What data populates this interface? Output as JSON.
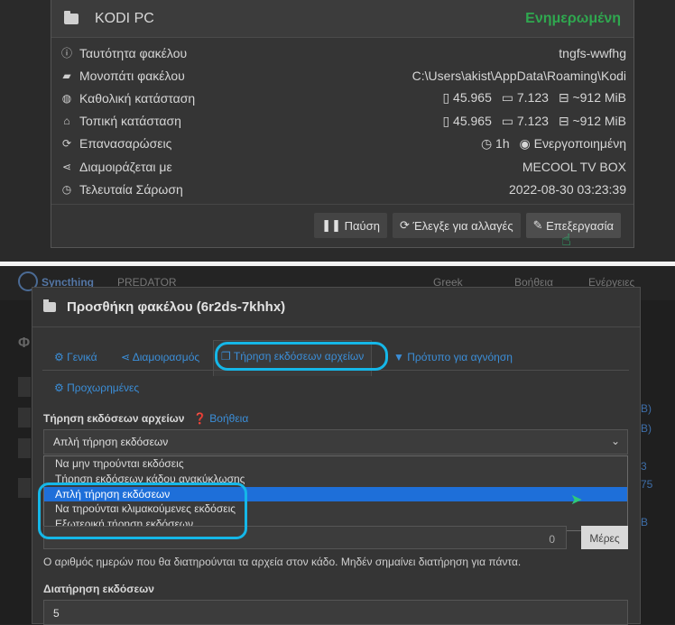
{
  "folder_panel": {
    "title": "KODI PC",
    "status": "Ενημερωμένη",
    "rows": [
      {
        "icon": "info-circle-icon",
        "label": "Ταυτότητα φακέλου",
        "value": "tngfs-wwfhg"
      },
      {
        "icon": "folder-open-icon",
        "label": "Μονοπάτι φακέλου",
        "value": "C:\\Users\\akist\\AppData\\Roaming\\Kodi"
      },
      {
        "icon": "globe-icon",
        "label": "Καθολική κατάσταση",
        "files": "45.965",
        "dirs": "7.123",
        "size": "~912 MiB"
      },
      {
        "icon": "home-icon",
        "label": "Τοπική κατάσταση",
        "files": "45.965",
        "dirs": "7.123",
        "size": "~912 MiB"
      },
      {
        "icon": "refresh-icon",
        "label": "Επανασαρώσεις",
        "interval": "1h",
        "watch": "Ενεργοποιημένη"
      },
      {
        "icon": "share-icon",
        "label": "Διαμοιράζεται με",
        "value": "MECOOL TV BOX"
      },
      {
        "icon": "clock-icon",
        "label": "Τελευταία Σάρωση",
        "value": "2022-08-30 03:23:39"
      }
    ],
    "buttons": {
      "pause": "Παύση",
      "rescan": "Έλεγξε για αλλαγές",
      "edit": "Επεξεργασία"
    }
  },
  "navbar": {
    "brand": "Syncthing",
    "device": "PREDATOR",
    "language": "Greek",
    "help": "Βοήθεια",
    "actions": "Ενέργειες"
  },
  "modal": {
    "title": "Προσθήκη φακέλου (6r2ds-7khhx)",
    "tabs": [
      {
        "label": "Γενικά",
        "icon": "cog-icon"
      },
      {
        "label": "Διαμοιρασμός",
        "icon": "share-icon"
      },
      {
        "label": "Τήρηση εκδόσεων αρχείων",
        "icon": "copy-icon",
        "active": true
      },
      {
        "label": "Πρότυπο για αγνόηση",
        "icon": "filter-icon"
      },
      {
        "label": "Προχωρημένες",
        "icon": "cogs-icon"
      }
    ],
    "versioning_label": "Τήρηση εκδόσεων αρχείων",
    "help_link": "Βοήθεια",
    "selected_value": "Απλή τήρηση εκδόσεων",
    "options": [
      "Να μην τηρούνται εκδόσεις",
      "Τήρηση εκδόσεων κάδου ανακύκλωσης",
      "Απλή τήρηση εκδόσεων",
      "Να τηρούνται κλιμακούμενες εκδόσεις",
      "Εξωτερική τήρηση εκδόσεων"
    ],
    "cleanout_days_value": "0",
    "days_addon": "Μέρες",
    "cleanout_hint": "Ο αριθμός ημερών που θα διατηρούνται τα αρχεία στον κάδο. Μηδέν σημαίνει διατήρηση για πάντα.",
    "keep_versions_label": "Διατήρηση εκδόσεων",
    "keep_versions_value": "5"
  }
}
